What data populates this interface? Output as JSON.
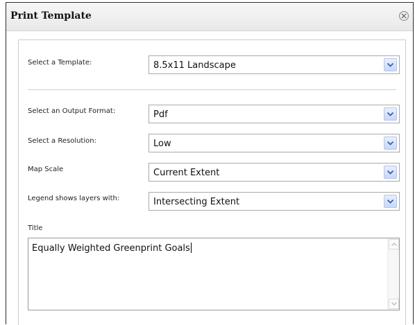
{
  "dialog": {
    "title": "Print Template",
    "close_icon": "close-icon"
  },
  "fields": {
    "template": {
      "label": "Select a Template:",
      "value": "8.5x11 Landscape"
    },
    "output_format": {
      "label": "Select an Output Format:",
      "value": "Pdf"
    },
    "resolution": {
      "label": "Select a Resolution:",
      "value": "Low"
    },
    "map_scale": {
      "label": "Map Scale",
      "value": "Current Extent"
    },
    "legend": {
      "label": "Legend shows layers with:",
      "value": "Intersecting Extent"
    },
    "title": {
      "label": "Title",
      "value": "Equally Weighted Greenprint Goals"
    }
  },
  "icons": {
    "dropdown": "chevron-down-icon",
    "scroll_up": "scroll-up-icon",
    "scroll_down": "scroll-down-icon"
  },
  "colors": {
    "dropdown_button": "#c9d8f6",
    "dropdown_chevron": "#3a5ea8"
  }
}
